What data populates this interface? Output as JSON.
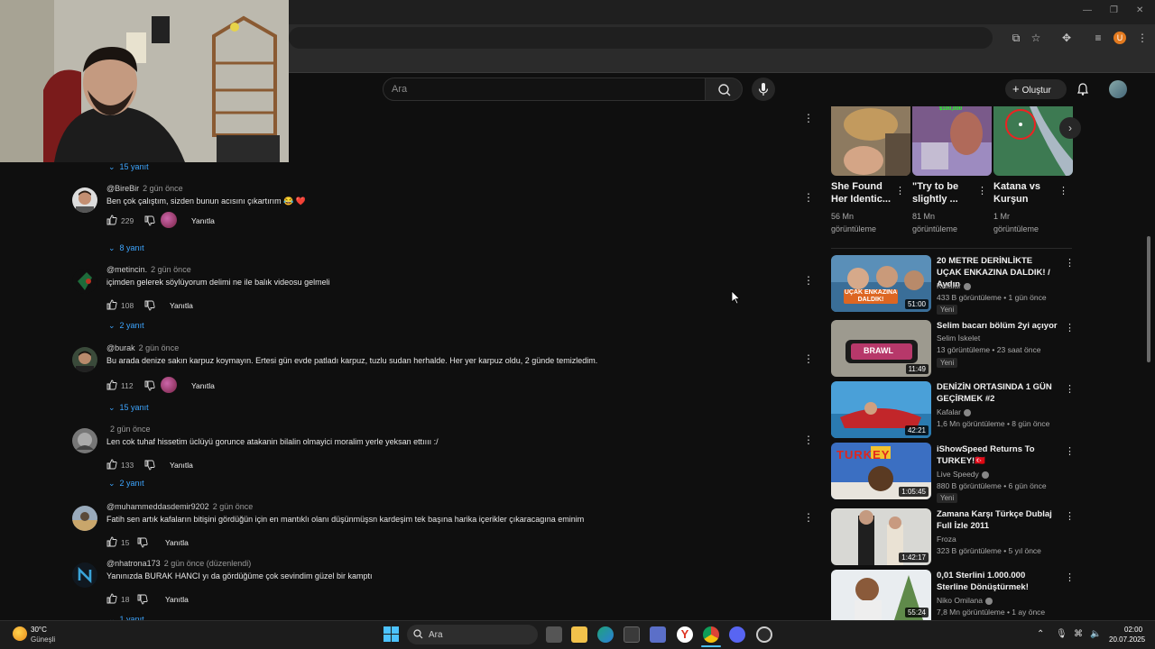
{
  "search": {
    "placeholder": "Ara"
  },
  "header": {
    "create_label": "Oluştur"
  },
  "comments": [
    {
      "author": "",
      "time": "",
      "text": "",
      "likes": "",
      "replies": "15 yanıt"
    },
    {
      "author": "@BireBir",
      "time": "2 gün önce",
      "text": "Ben çok çalıştım, sizden bunun acısını çıkartırım 😂 ❤️",
      "likes": "229",
      "reply_label": "Yanıtla",
      "replies": "8 yanıt"
    },
    {
      "author": "@metincin.",
      "time": "2 gün önce",
      "text": "içimden gelerek söylüyorum delimi ne ile balık videosu gelmeli",
      "likes": "108",
      "reply_label": "Yanıtla",
      "replies": "2 yanıt"
    },
    {
      "author": "@burak",
      "time": "2 gün önce",
      "text": "Bu arada denize sakın karpuz koymayın. Ertesi gün evde patladı karpuz, tuzlu sudan herhalde. Her yer karpuz oldu, 2 günde temizledim.",
      "likes": "112",
      "reply_label": "Yanıtla",
      "replies": "15 yanıt"
    },
    {
      "author": "",
      "time": "2 gün önce",
      "text": "Len cok tuhaf hissetim üclüyü gorunce atakanin bilalin olmayici moralim yerle yeksan ettıııı :/",
      "likes": "133",
      "reply_label": "Yanıtla",
      "replies": "2 yanıt"
    },
    {
      "author": "@muhammeddasdemir9202",
      "time": "2 gün önce",
      "text": "Fatih sen artık kafaların bitişini gördüğün için en mantıklı olanı düşünmüşsn kardeşim tek başına harika içerikler çıkaracagına eminim",
      "likes": "15",
      "reply_label": "Yanıtla"
    },
    {
      "author": "@nhatrona173",
      "time": "2 gün önce (düzenlendi)",
      "text": "Yanınızda BURAK HANCI  yı da gördüğüme çok sevindim güzel bir kamptı",
      "likes": "18",
      "reply_label": "Yanıtla",
      "replies": "1 yanıt"
    }
  ],
  "shorts": [
    {
      "title": "She Found Her Identic...",
      "views": "56 Mn görüntüleme"
    },
    {
      "title": "\"Try to be slightly ...",
      "views": "81 Mn görüntüleme",
      "thumb_text": "$100,000"
    },
    {
      "title": "Katana vs Kurşun",
      "views": "1 Mr görüntüleme"
    }
  ],
  "videos": [
    {
      "title": "20 METRE DERİNLİKTE UÇAK ENKAZINA DALDIK! / Aydın",
      "channel": "Kafalar",
      "meta": "433 B görüntüleme • 1 gün önce",
      "badge": "Yeni",
      "duration": "51:00",
      "thumb_text": "UÇAK ENKAZINA DALDIK!"
    },
    {
      "title": "Selim bacarı bölüm 2yi açıyor",
      "channel": "Selim İskelet",
      "meta": "13 görüntüleme • 23 saat önce",
      "badge": "Yeni",
      "duration": "11:49",
      "thumb_text": "BRAWL"
    },
    {
      "title": "DENİZİN ORTASINDA 1 GÜN GEÇİRMEK #2",
      "channel": "Kafalar",
      "meta": "1,6 Mn görüntüleme • 8 gün önce",
      "duration": "42:21"
    },
    {
      "title": "iShowSpeed Returns To TURKEY!🇹🇷",
      "channel": "Live Speedy",
      "meta": "880 B görüntüleme • 6 gün önce",
      "badge": "Yeni",
      "duration": "1:05:45",
      "thumb_text": "TURKEY"
    },
    {
      "title": "Zamana Karşı Türkçe Dublaj Full İzle 2011",
      "channel": "Froza",
      "meta": "323 B görüntüleme • 5 yıl önce",
      "duration": "1:42:17"
    },
    {
      "title": "0,01 Sterlini 1.000.000 Sterline Dönüştürmek!",
      "channel": "Niko Omilana",
      "meta": "7,8 Mn görüntüleme • 1 ay önce",
      "duration": "55:24"
    }
  ],
  "taskbar": {
    "temp": "30°C",
    "weather": "Güneşli",
    "search": "Ara",
    "time": "02:00",
    "date": "20.07.2025"
  },
  "colors": {
    "background": "#0f0f0f",
    "link": "#3ea6ff",
    "accent_red": "#ff0000"
  }
}
